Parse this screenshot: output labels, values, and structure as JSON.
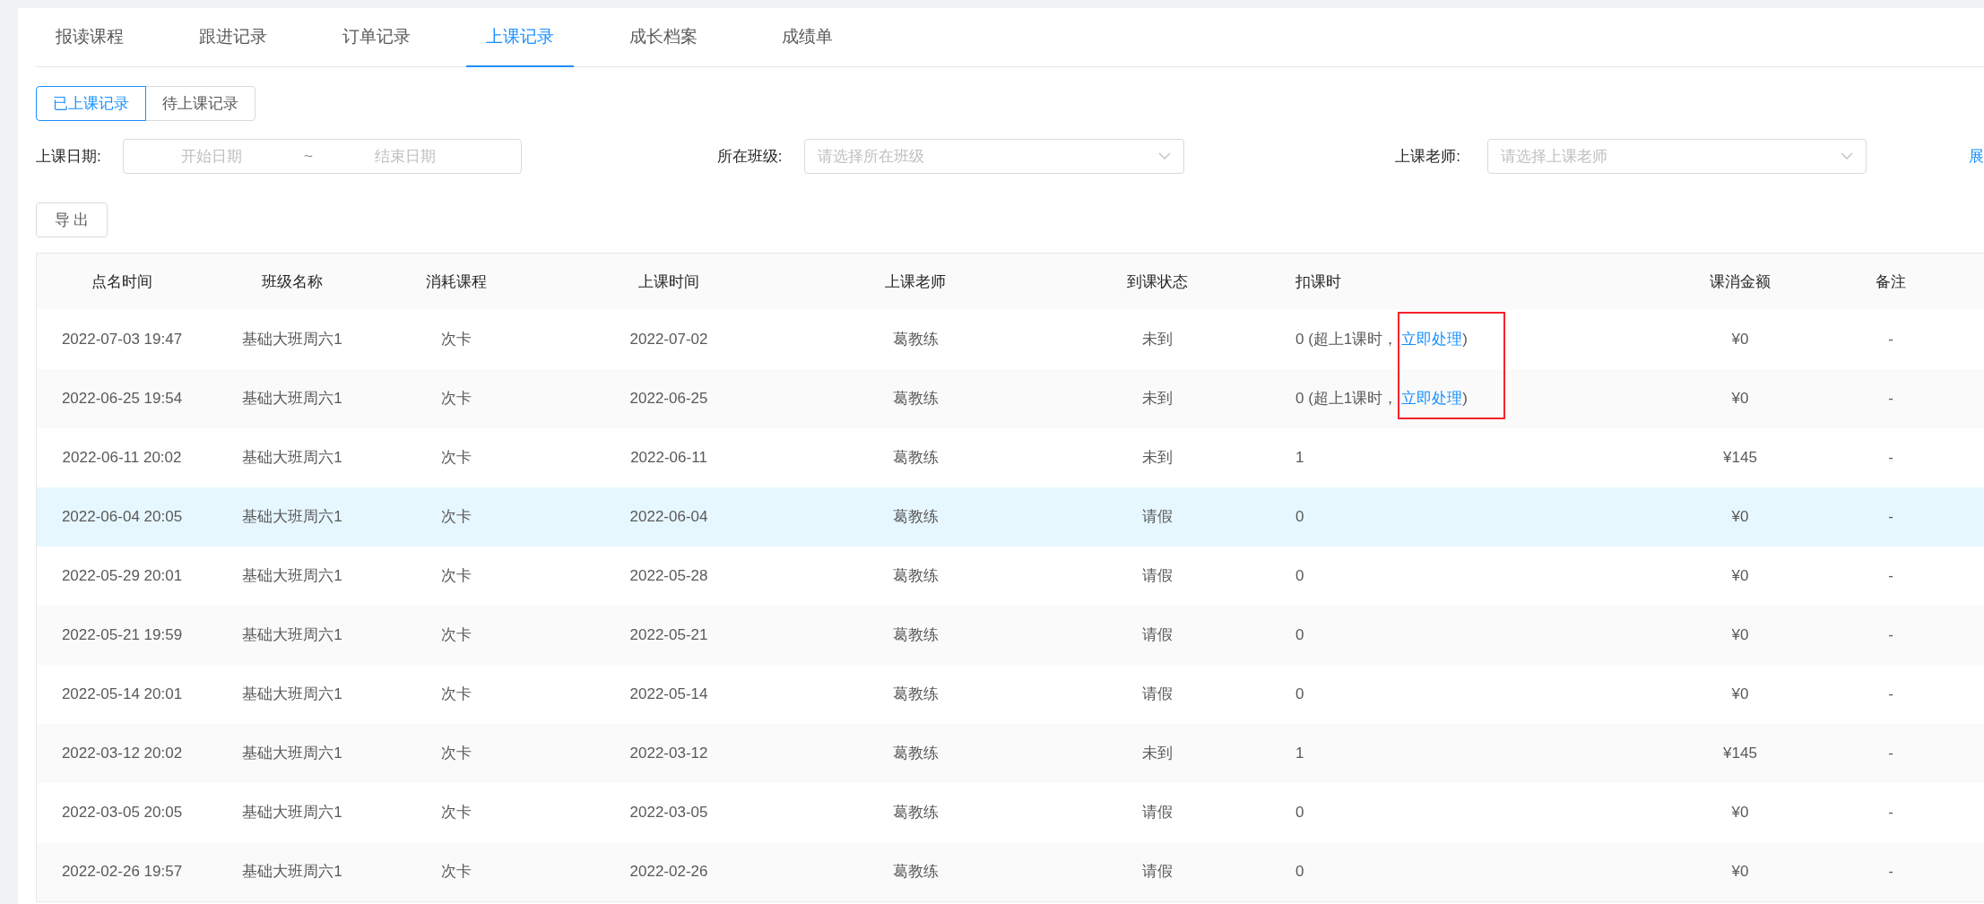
{
  "tabs": [
    {
      "label": "报读课程",
      "selected": false
    },
    {
      "label": "跟进记录",
      "selected": false
    },
    {
      "label": "订单记录",
      "selected": false
    },
    {
      "label": "上课记录",
      "selected": true
    },
    {
      "label": "成长档案",
      "selected": false
    },
    {
      "label": "成绩单",
      "selected": false
    }
  ],
  "record_switch": [
    {
      "label": "已上课记录",
      "selected": true
    },
    {
      "label": "待上课记录",
      "selected": false
    }
  ],
  "filters": {
    "date": {
      "label": "上课日期:",
      "start_placeholder": "开始日期",
      "separator": "~",
      "end_placeholder": "结束日期"
    },
    "class": {
      "label": "所在班级:",
      "placeholder": "请选择所在班级"
    },
    "teacher": {
      "label": "上课老师:",
      "placeholder": "请选择上课老师"
    },
    "expand_link": "展"
  },
  "export_button": "导 出",
  "table": {
    "columns": [
      "点名时间",
      "班级名称",
      "消耗课程",
      "上课时间",
      "上课老师",
      "到课状态",
      "扣课时",
      "课消金额",
      "备注"
    ],
    "rows": [
      {
        "roll_call_time": "2022-07-03 19:47",
        "class_name": "基础大班周六1",
        "course": "次卡",
        "class_date": "2022-07-02",
        "teacher": "葛教练",
        "attendance": "未到",
        "deduction": "0 (超上1课时，",
        "action": "立即处理",
        "action_suffix": ")",
        "amount": "¥0",
        "remark": "-",
        "highlighted": false,
        "flagged": true
      },
      {
        "roll_call_time": "2022-06-25 19:54",
        "class_name": "基础大班周六1",
        "course": "次卡",
        "class_date": "2022-06-25",
        "teacher": "葛教练",
        "attendance": "未到",
        "deduction": "0 (超上1课时，",
        "action": "立即处理",
        "action_suffix": ")",
        "amount": "¥0",
        "remark": "-",
        "highlighted": false,
        "flagged": true
      },
      {
        "roll_call_time": "2022-06-11 20:02",
        "class_name": "基础大班周六1",
        "course": "次卡",
        "class_date": "2022-06-11",
        "teacher": "葛教练",
        "attendance": "未到",
        "deduction": "1",
        "amount": "¥145",
        "remark": "-",
        "highlighted": false
      },
      {
        "roll_call_time": "2022-06-04 20:05",
        "class_name": "基础大班周六1",
        "course": "次卡",
        "class_date": "2022-06-04",
        "teacher": "葛教练",
        "attendance": "请假",
        "deduction": "0",
        "amount": "¥0",
        "remark": "-",
        "highlighted": true
      },
      {
        "roll_call_time": "2022-05-29 20:01",
        "class_name": "基础大班周六1",
        "course": "次卡",
        "class_date": "2022-05-28",
        "teacher": "葛教练",
        "attendance": "请假",
        "deduction": "0",
        "amount": "¥0",
        "remark": "-",
        "highlighted": false
      },
      {
        "roll_call_time": "2022-05-21 19:59",
        "class_name": "基础大班周六1",
        "course": "次卡",
        "class_date": "2022-05-21",
        "teacher": "葛教练",
        "attendance": "请假",
        "deduction": "0",
        "amount": "¥0",
        "remark": "-",
        "highlighted": false
      },
      {
        "roll_call_time": "2022-05-14 20:01",
        "class_name": "基础大班周六1",
        "course": "次卡",
        "class_date": "2022-05-14",
        "teacher": "葛教练",
        "attendance": "请假",
        "deduction": "0",
        "amount": "¥0",
        "remark": "-",
        "highlighted": false
      },
      {
        "roll_call_time": "2022-03-12 20:02",
        "class_name": "基础大班周六1",
        "course": "次卡",
        "class_date": "2022-03-12",
        "teacher": "葛教练",
        "attendance": "未到",
        "deduction": "1",
        "amount": "¥145",
        "remark": "-",
        "highlighted": false
      },
      {
        "roll_call_time": "2022-03-05 20:05",
        "class_name": "基础大班周六1",
        "course": "次卡",
        "class_date": "2022-03-05",
        "teacher": "葛教练",
        "attendance": "请假",
        "deduction": "0",
        "amount": "¥0",
        "remark": "-",
        "highlighted": false
      },
      {
        "roll_call_time": "2022-02-26 19:57",
        "class_name": "基础大班周六1",
        "course": "次卡",
        "class_date": "2022-02-26",
        "teacher": "葛教练",
        "attendance": "请假",
        "deduction": "0",
        "amount": "¥0",
        "remark": "-",
        "highlighted": false
      }
    ]
  }
}
